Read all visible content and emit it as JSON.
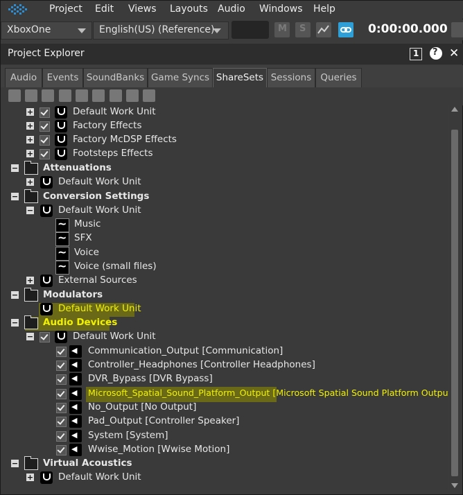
{
  "menu": [
    "Project",
    "Edit",
    "Views",
    "Layouts",
    "Audio",
    "Windows",
    "Help"
  ],
  "toolbar": {
    "platform": "XboxOne",
    "language": "English(US) (Reference)",
    "mute_label": "M",
    "solo_label": "S",
    "timecode": "0:00:00.000"
  },
  "panel": {
    "title": "Project Explorer",
    "badge": "1",
    "help": "?",
    "close": "✕"
  },
  "tabs": [
    "Audio",
    "Events",
    "SoundBanks",
    "Game Syncs",
    "ShareSets",
    "Sessions",
    "Queries"
  ],
  "active_tab": "ShareSets",
  "tree": [
    {
      "label": "Default Work Unit",
      "type": "work-unit",
      "checked": true
    },
    {
      "label": "Factory Effects",
      "type": "work-unit",
      "checked": true
    },
    {
      "label": "Factory McDSP Effects",
      "type": "work-unit",
      "checked": true
    },
    {
      "label": "Footsteps Effects",
      "type": "work-unit",
      "checked": true
    },
    {
      "label": "Attenuations",
      "type": "folder"
    },
    {
      "label": "Default Work Unit",
      "type": "work-unit"
    },
    {
      "label": "Conversion Settings",
      "type": "folder"
    },
    {
      "label": "Default Work Unit",
      "type": "work-unit"
    },
    {
      "label": "Music",
      "type": "conversion"
    },
    {
      "label": "SFX",
      "type": "conversion"
    },
    {
      "label": "Voice",
      "type": "conversion"
    },
    {
      "label": "Voice (small files)",
      "type": "conversion"
    },
    {
      "label": "External Sources",
      "type": "work-unit"
    },
    {
      "label": "Modulators",
      "type": "folder"
    },
    {
      "label": "Default Work Unit",
      "type": "work-unit"
    },
    {
      "label": "Audio Devices",
      "type": "folder"
    },
    {
      "label": "Default Work Unit",
      "type": "work-unit",
      "checked": true
    },
    {
      "label": "Communication_Output [Communication]",
      "type": "device",
      "checked": true
    },
    {
      "label": "Controller_Headphones [Controller Headphones]",
      "type": "device",
      "checked": true
    },
    {
      "label": "DVR_Bypass [DVR Bypass]",
      "type": "device",
      "checked": true
    },
    {
      "label": "Microsoft_Spatial_Sound_Platform_Output [Microsoft Spatial Sound Platform Output]",
      "type": "device",
      "checked": true
    },
    {
      "label": "No_Output [No Output]",
      "type": "device",
      "checked": true
    },
    {
      "label": "Pad_Output [Controller Speaker]",
      "type": "device",
      "checked": true
    },
    {
      "label": "System [System]",
      "type": "device",
      "checked": true
    },
    {
      "label": "Wwise_Motion [Wwise Motion]",
      "type": "device",
      "checked": true
    },
    {
      "label": "Virtual Acoustics",
      "type": "folder"
    },
    {
      "label": "Default Work Unit",
      "type": "work-unit"
    }
  ],
  "colors": {
    "highlight": "#f2f200",
    "link_button": "#2f9fd8",
    "background": "#3a3a3a"
  }
}
